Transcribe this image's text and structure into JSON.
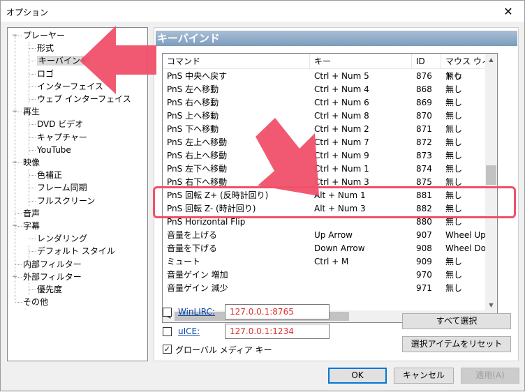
{
  "window": {
    "title": "オプション",
    "close": "✕"
  },
  "tree": {
    "items": [
      {
        "label": "プレーヤー",
        "expander": "−"
      },
      {
        "label": "形式"
      },
      {
        "label": "キーバインド"
      },
      {
        "label": "ロゴ"
      },
      {
        "label": "インターフェイス"
      },
      {
        "label": "ウェブ インターフェイス"
      },
      {
        "label": "再生",
        "expander": "−"
      },
      {
        "label": "DVD ビデオ"
      },
      {
        "label": "キャプチャー"
      },
      {
        "label": "YouTube"
      },
      {
        "label": "映像",
        "expander": "−"
      },
      {
        "label": "色補正"
      },
      {
        "label": "フレーム同期"
      },
      {
        "label": "フルスクリーン"
      },
      {
        "label": "音声"
      },
      {
        "label": "字幕",
        "expander": "−"
      },
      {
        "label": "レンダリング"
      },
      {
        "label": "デフォルト スタイル"
      },
      {
        "label": "内部フィルター"
      },
      {
        "label": "外部フィルター",
        "expander": "−"
      },
      {
        "label": "優先度"
      },
      {
        "label": "その他"
      }
    ]
  },
  "panel": {
    "title": "キーバインド",
    "columns": [
      "コマンド",
      "キー",
      "ID",
      "マウス ウィンドウ"
    ],
    "rows": [
      [
        "PnS 中央へ戻す",
        "Ctrl + Num 5",
        "876",
        "無し"
      ],
      [
        "PnS 左へ移動",
        "Ctrl + Num 4",
        "868",
        "無し"
      ],
      [
        "PnS 右へ移動",
        "Ctrl + Num 6",
        "869",
        "無し"
      ],
      [
        "PnS 上へ移動",
        "Ctrl + Num 8",
        "870",
        "無し"
      ],
      [
        "PnS 下へ移動",
        "Ctrl + Num 2",
        "871",
        "無し"
      ],
      [
        "PnS 左上へ移動",
        "Ctrl + Num 7",
        "872",
        "無し"
      ],
      [
        "PnS 右上へ移動",
        "Ctrl + Num 9",
        "873",
        "無し"
      ],
      [
        "PnS 左下へ移動",
        "Ctrl + Num 1",
        "874",
        "無し"
      ],
      [
        "PnS 右下へ移動",
        "Ctrl + Num 3",
        "875",
        "無し"
      ],
      [
        "PnS 回転 Z+ (反時計回り)",
        "Alt + Num 1",
        "881",
        "無し"
      ],
      [
        "PnS 回転 Z- (時計回り)",
        "Alt + Num 3",
        "882",
        "無し"
      ],
      [
        "PnS Horizontal Flip",
        "",
        "880",
        "無し"
      ],
      [
        "音量を上げる",
        "Up Arrow",
        "907",
        "Wheel Up"
      ],
      [
        "音量を下げる",
        "Down Arrow",
        "908",
        "Wheel Down"
      ],
      [
        "ミュート",
        "Ctrl + M",
        "909",
        "無し"
      ],
      [
        "音量ゲイン 増加",
        "",
        "970",
        "無し"
      ],
      [
        "音量ゲイン 減少",
        "",
        "971",
        "無し"
      ]
    ],
    "winlirc": {
      "label": "WinLIRC:",
      "value": "127.0.0.1:8765"
    },
    "uice": {
      "label": "uICE:",
      "value": "127.0.0.1:1234"
    },
    "global_media_keys": {
      "label": "グローバル メディア キー"
    },
    "select_all": "すべて選択",
    "reset_selected": "選択アイテムをリセット"
  },
  "buttons": {
    "ok": "OK",
    "cancel": "キャンセル",
    "apply": "適用(A)"
  },
  "colors": {
    "arrow": "#f0506a",
    "highlight_box": "#f0506a"
  }
}
